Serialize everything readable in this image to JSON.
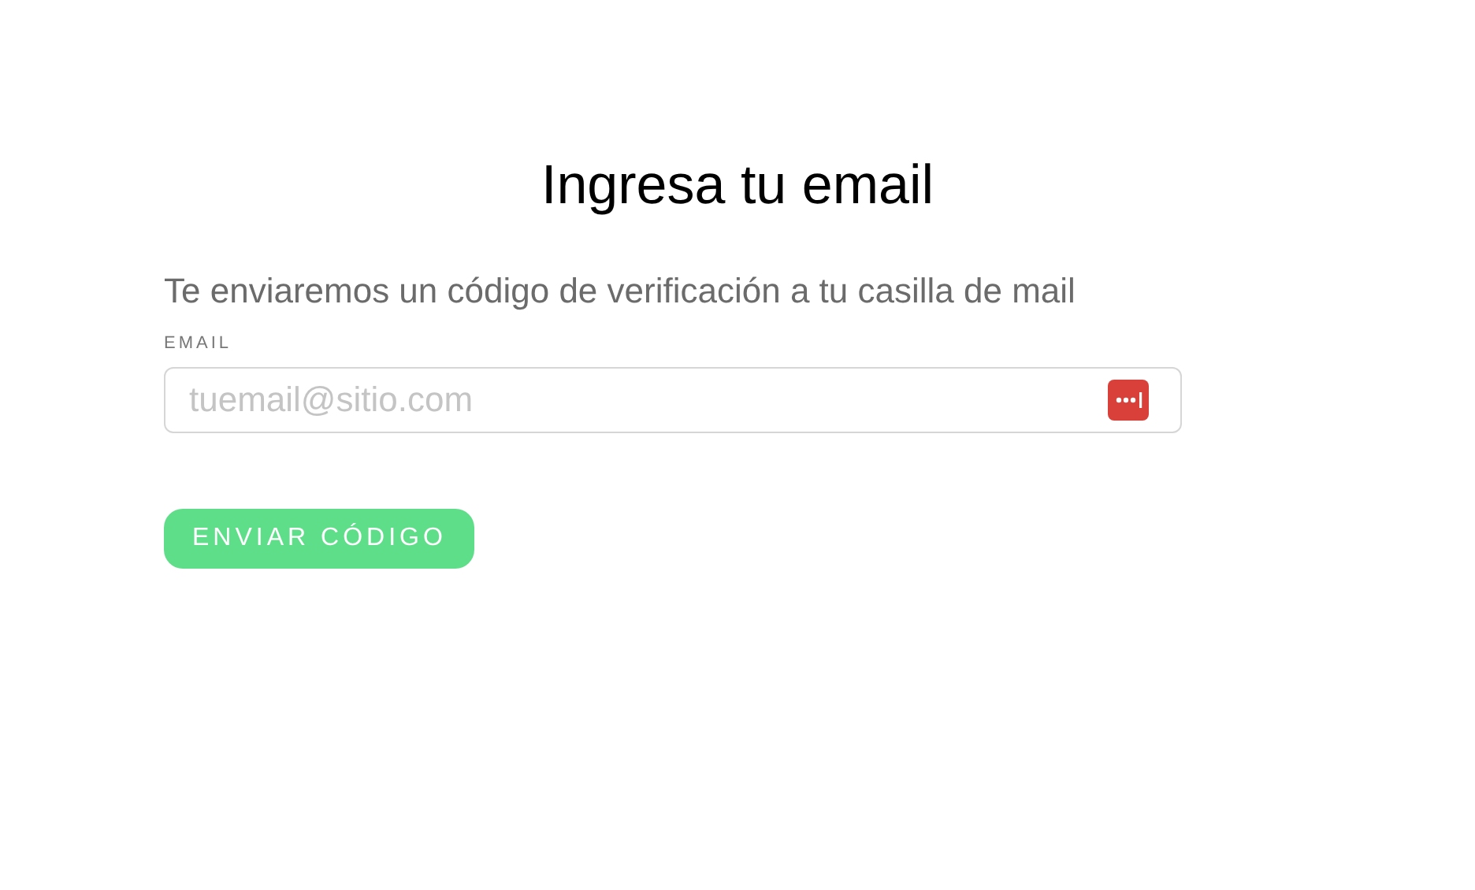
{
  "title": "Ingresa tu email",
  "subtitle": "Te enviaremos un código de verificación a tu casilla de mail",
  "email_field": {
    "label": "EMAIL",
    "placeholder": "tuemail@sitio.com"
  },
  "submit_button": "ENVIAR CÓDIGO"
}
